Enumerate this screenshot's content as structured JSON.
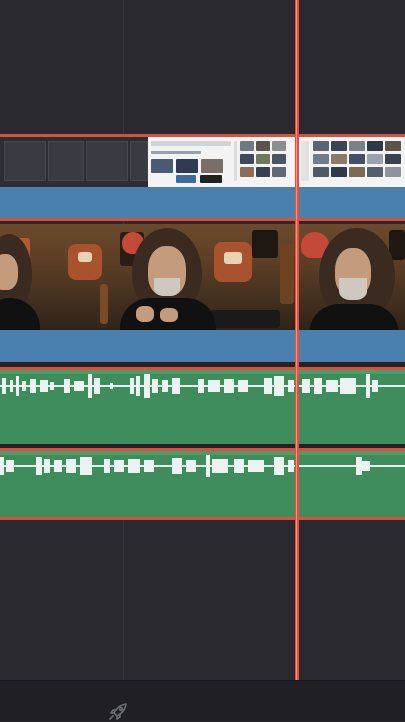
{
  "app": {
    "name": ""
  },
  "colors": {
    "background": "#29292f",
    "selection_border": "#d9513c",
    "video_bar": "#4a80ad",
    "audio_track": "#3f8c5c",
    "playhead": "#e0523f",
    "bottom_bar": "#1f1f24"
  },
  "tracks": [
    {
      "kind": "video",
      "name": ""
    },
    {
      "kind": "video",
      "name": ""
    },
    {
      "kind": "audio",
      "name": ""
    },
    {
      "kind": "audio",
      "name": ""
    }
  ],
  "toolbar": {
    "icon": "rocket-icon"
  }
}
